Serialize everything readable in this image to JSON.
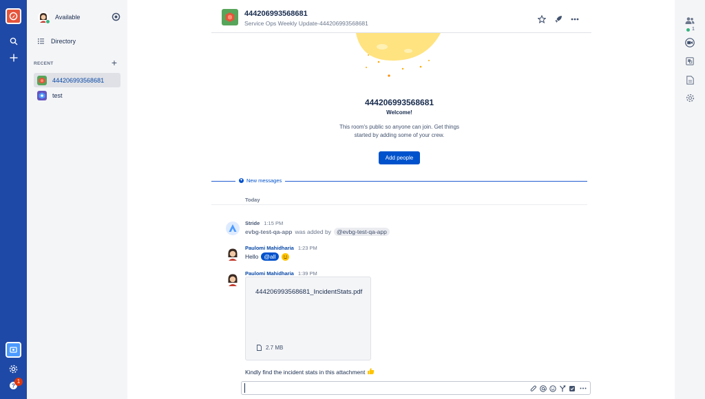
{
  "sidebar": {
    "status_label": "Available",
    "directory_label": "Directory",
    "recent_label": "RECENT",
    "rooms": [
      {
        "name": "444206993568681",
        "active": true
      },
      {
        "name": "test",
        "active": false
      }
    ]
  },
  "header": {
    "title": "444206993568681",
    "topic": "Service Ops Weekly Update-444206993568681"
  },
  "welcome": {
    "title": "444206993568681",
    "subtitle": "Welcome!",
    "description": "This room's public so anyone can join. Get things started by adding some of your crew.",
    "add_people_label": "Add people"
  },
  "divider": {
    "new_messages_label": "New messages",
    "date_label": "Today"
  },
  "messages": [
    {
      "author": "Stride",
      "time": "1:15 PM",
      "user": "evbg-test-qa-app",
      "middle": "was added by",
      "mention": "@evbg-test-qa-app"
    },
    {
      "author": "Paulomi Mahidharia",
      "time": "1:23 PM",
      "text": "Hello",
      "mention": "@all"
    },
    {
      "author": "Paulomi Mahidharia",
      "time": "1:39 PM",
      "file_name": "444206993568681_IncidentStats.pdf",
      "file_size": "2.7 MB",
      "text": "Kindly find the incident stats in this attachment"
    }
  ],
  "composer": {
    "value": "",
    "placeholder": ""
  },
  "right_rail": {
    "member_count": "1"
  },
  "rail": {
    "notification_count": "1"
  },
  "colors": {
    "rail": "#1f49a6",
    "accent": "#0052cc",
    "sidebar": "#f4f5f7",
    "status_online": "#36b37e",
    "badge": "#de350b"
  },
  "icons": [
    "app-logo-icon",
    "search-icon",
    "plus-icon",
    "stride-app-icon",
    "settings-icon",
    "help-icon",
    "settings-circle-icon",
    "list-icon",
    "star-icon",
    "rocket-icon",
    "more-icon",
    "people-icon",
    "video-icon",
    "integrations-icon",
    "files-icon",
    "gear-icon",
    "paperclip-icon",
    "mention-icon",
    "emoji-icon",
    "decision-icon",
    "task-icon",
    "file-icon"
  ]
}
